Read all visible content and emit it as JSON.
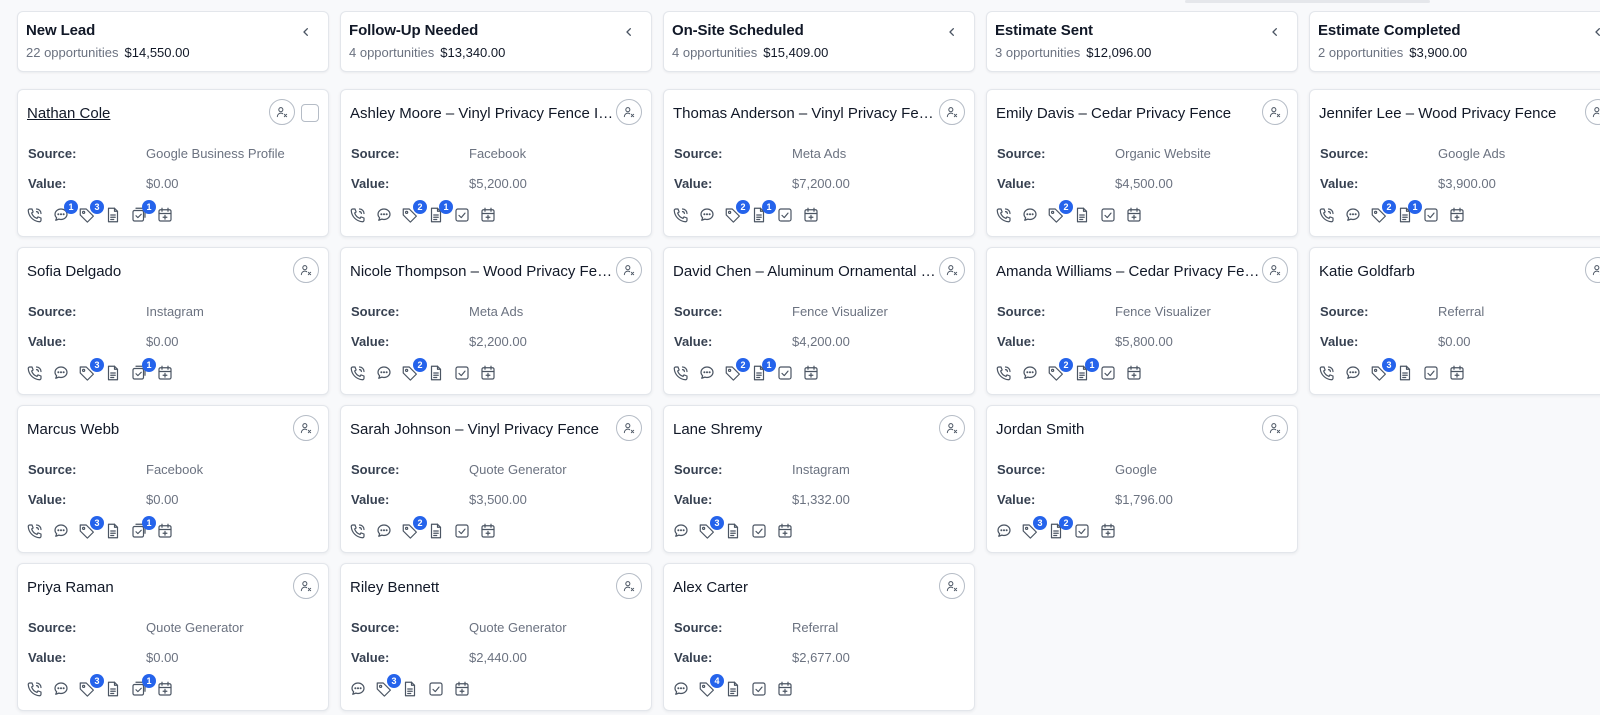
{
  "colors": {
    "badge": "#2563eb",
    "card_bg": "#ffffff",
    "page_bg": "#f8f9fb"
  },
  "labels": {
    "source": "Source:",
    "value": "Value:"
  },
  "columns": [
    {
      "title": "New Lead",
      "count": "22 opportunities",
      "amount": "$14,550.00",
      "cards": [
        {
          "name": "Nathan Cole",
          "link": true,
          "checkbox": true,
          "source": "Google Business Profile",
          "value": "$0.00",
          "actions": [
            {
              "icon": "phone-icon"
            },
            {
              "icon": "message-icon",
              "badge": "1"
            },
            {
              "icon": "tag-icon",
              "badge": "3"
            },
            {
              "icon": "document-icon"
            },
            {
              "icon": "task-icon",
              "badge": "1"
            },
            {
              "icon": "calendar-icon"
            }
          ]
        },
        {
          "name": "Sofia Delgado",
          "source": "Instagram",
          "value": "$0.00",
          "actions": [
            {
              "icon": "phone-icon"
            },
            {
              "icon": "message-icon"
            },
            {
              "icon": "tag-icon",
              "badge": "3"
            },
            {
              "icon": "document-icon"
            },
            {
              "icon": "task-icon",
              "badge": "1"
            },
            {
              "icon": "calendar-icon"
            }
          ]
        },
        {
          "name": "Marcus Webb",
          "source": "Facebook",
          "value": "$0.00",
          "actions": [
            {
              "icon": "phone-icon"
            },
            {
              "icon": "message-icon"
            },
            {
              "icon": "tag-icon",
              "badge": "3"
            },
            {
              "icon": "document-icon"
            },
            {
              "icon": "task-icon",
              "badge": "1"
            },
            {
              "icon": "calendar-icon"
            }
          ]
        },
        {
          "name": "Priya Raman",
          "source": "Quote Generator",
          "value": "$0.00",
          "actions": [
            {
              "icon": "phone-icon"
            },
            {
              "icon": "message-icon"
            },
            {
              "icon": "tag-icon",
              "badge": "3"
            },
            {
              "icon": "document-icon"
            },
            {
              "icon": "task-icon",
              "badge": "1"
            },
            {
              "icon": "calendar-icon"
            }
          ]
        }
      ]
    },
    {
      "title": "Follow-Up Needed",
      "count": "4 opportunities",
      "amount": "$13,340.00",
      "cards": [
        {
          "name": "Ashley Moore – Vinyl Privacy Fence Installation",
          "source": "Facebook",
          "value": "$5,200.00",
          "actions": [
            {
              "icon": "phone-icon"
            },
            {
              "icon": "message-icon"
            },
            {
              "icon": "tag-icon",
              "badge": "2"
            },
            {
              "icon": "document-icon",
              "badge": "1"
            },
            {
              "icon": "checkbox-icon"
            },
            {
              "icon": "calendar-icon"
            }
          ]
        },
        {
          "name": "Nicole Thompson – Wood Privacy Fence",
          "source": "Meta Ads",
          "value": "$2,200.00",
          "actions": [
            {
              "icon": "phone-icon"
            },
            {
              "icon": "message-icon"
            },
            {
              "icon": "tag-icon",
              "badge": "2"
            },
            {
              "icon": "document-icon"
            },
            {
              "icon": "checkbox-icon"
            },
            {
              "icon": "calendar-icon"
            }
          ]
        },
        {
          "name": "Sarah Johnson – Vinyl Privacy Fence",
          "source": "Quote Generator",
          "value": "$3,500.00",
          "actions": [
            {
              "icon": "phone-icon"
            },
            {
              "icon": "message-icon"
            },
            {
              "icon": "tag-icon",
              "badge": "2"
            },
            {
              "icon": "document-icon"
            },
            {
              "icon": "checkbox-icon"
            },
            {
              "icon": "calendar-icon"
            }
          ]
        },
        {
          "name": "Riley Bennett",
          "source": "Quote Generator",
          "value": "$2,440.00",
          "actions": [
            {
              "icon": "message-icon"
            },
            {
              "icon": "tag-icon",
              "badge": "3"
            },
            {
              "icon": "document-icon"
            },
            {
              "icon": "checkbox-icon"
            },
            {
              "icon": "calendar-icon"
            }
          ]
        }
      ]
    },
    {
      "title": "On-Site Scheduled",
      "count": "4 opportunities",
      "amount": "$15,409.00",
      "cards": [
        {
          "name": "Thomas Anderson – Vinyl Privacy Fence",
          "source": "Meta Ads",
          "value": "$7,200.00",
          "actions": [
            {
              "icon": "phone-icon"
            },
            {
              "icon": "message-icon"
            },
            {
              "icon": "tag-icon",
              "badge": "2"
            },
            {
              "icon": "document-icon",
              "badge": "1"
            },
            {
              "icon": "checkbox-icon"
            },
            {
              "icon": "calendar-icon"
            }
          ]
        },
        {
          "name": "David Chen – Aluminum Ornamental Fence",
          "source": "Fence Visualizer",
          "value": "$4,200.00",
          "actions": [
            {
              "icon": "phone-icon"
            },
            {
              "icon": "message-icon"
            },
            {
              "icon": "tag-icon",
              "badge": "2"
            },
            {
              "icon": "document-icon",
              "badge": "1"
            },
            {
              "icon": "checkbox-icon"
            },
            {
              "icon": "calendar-icon"
            }
          ]
        },
        {
          "name": "Lane Shremy",
          "source": "Instagram",
          "value": "$1,332.00",
          "actions": [
            {
              "icon": "message-icon"
            },
            {
              "icon": "tag-icon",
              "badge": "3"
            },
            {
              "icon": "document-icon"
            },
            {
              "icon": "checkbox-icon"
            },
            {
              "icon": "calendar-icon"
            }
          ]
        },
        {
          "name": "Alex Carter",
          "source": "Referral",
          "value": "$2,677.00",
          "actions": [
            {
              "icon": "message-icon"
            },
            {
              "icon": "tag-icon",
              "badge": "4"
            },
            {
              "icon": "document-icon"
            },
            {
              "icon": "checkbox-icon"
            },
            {
              "icon": "calendar-icon"
            }
          ]
        }
      ]
    },
    {
      "title": "Estimate Sent",
      "count": "3 opportunities",
      "amount": "$12,096.00",
      "cards": [
        {
          "name": "Emily Davis – Cedar Privacy Fence",
          "source": "Organic Website",
          "value": "$4,500.00",
          "actions": [
            {
              "icon": "phone-icon"
            },
            {
              "icon": "message-icon"
            },
            {
              "icon": "tag-icon",
              "badge": "2"
            },
            {
              "icon": "document-icon"
            },
            {
              "icon": "checkbox-icon"
            },
            {
              "icon": "calendar-icon"
            }
          ]
        },
        {
          "name": "Amanda Williams – Cedar Privacy Fence",
          "source": "Fence Visualizer",
          "value": "$5,800.00",
          "actions": [
            {
              "icon": "phone-icon"
            },
            {
              "icon": "message-icon"
            },
            {
              "icon": "tag-icon",
              "badge": "2"
            },
            {
              "icon": "document-icon",
              "badge": "1"
            },
            {
              "icon": "checkbox-icon"
            },
            {
              "icon": "calendar-icon"
            }
          ]
        },
        {
          "name": "Jordan Smith",
          "source": "Google",
          "value": "$1,796.00",
          "actions": [
            {
              "icon": "message-icon"
            },
            {
              "icon": "tag-icon",
              "badge": "3"
            },
            {
              "icon": "document-icon",
              "badge": "2"
            },
            {
              "icon": "checkbox-icon"
            },
            {
              "icon": "calendar-icon"
            }
          ]
        }
      ]
    },
    {
      "title": "Estimate Completed",
      "count": "2 opportunities",
      "amount": "$3,900.00",
      "cards": [
        {
          "name": "Jennifer Lee – Wood Privacy Fence",
          "source": "Google Ads",
          "value": "$3,900.00",
          "actions": [
            {
              "icon": "phone-icon"
            },
            {
              "icon": "message-icon"
            },
            {
              "icon": "tag-icon",
              "badge": "2"
            },
            {
              "icon": "document-icon",
              "badge": "1"
            },
            {
              "icon": "checkbox-icon"
            },
            {
              "icon": "calendar-icon"
            }
          ]
        },
        {
          "name": "Katie Goldfarb",
          "source": "Referral",
          "value": "$0.00",
          "actions": [
            {
              "icon": "phone-icon"
            },
            {
              "icon": "message-icon"
            },
            {
              "icon": "tag-icon",
              "badge": "3"
            },
            {
              "icon": "document-icon"
            },
            {
              "icon": "checkbox-icon"
            },
            {
              "icon": "calendar-icon"
            }
          ]
        }
      ]
    }
  ]
}
